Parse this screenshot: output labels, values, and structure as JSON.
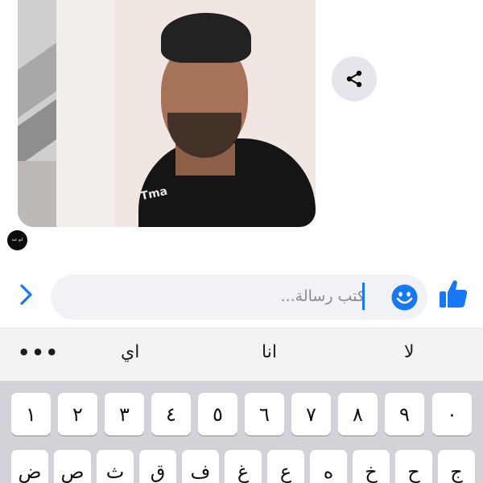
{
  "chat": {
    "sender_avatar_text": "ابو عيد",
    "photo_print_text": "Tma"
  },
  "composer": {
    "placeholder": "كتب رسالة...",
    "accent_color": "#1877f2"
  },
  "icons": [
    "share-icon",
    "chevron-right-icon",
    "smiley-icon",
    "thumbs-up-icon"
  ],
  "keyboard": {
    "suggestions": [
      "لا",
      "انا",
      "اي"
    ],
    "more_label": "•••",
    "row1": [
      "١",
      "٢",
      "٣",
      "٤",
      "٥",
      "٦",
      "٧",
      "٨",
      "٩",
      "٠"
    ],
    "row2": [
      "ض",
      "ص",
      "ث",
      "ق",
      "ف",
      "غ",
      "ع",
      "ه",
      "خ",
      "ح",
      "ج"
    ]
  }
}
